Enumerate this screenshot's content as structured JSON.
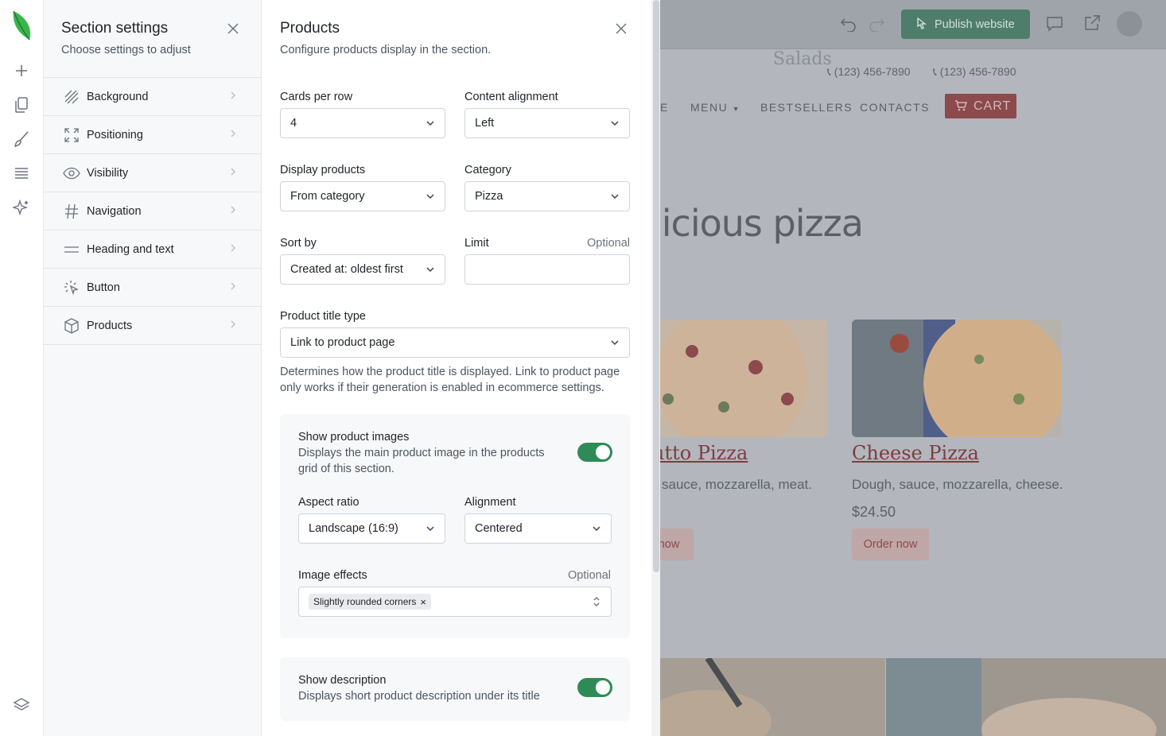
{
  "rail": {
    "icons": [
      "logo-leaf-icon",
      "add-icon",
      "pages-icon",
      "brush-icon",
      "sections-icon",
      "ai-sparkle-icon",
      "layers-icon"
    ]
  },
  "section_settings": {
    "title": "Section settings",
    "subtitle": "Choose settings to adjust",
    "items": [
      {
        "label": "Background",
        "icon": "background-hatch-icon"
      },
      {
        "label": "Positioning",
        "icon": "positioning-expand-icon"
      },
      {
        "label": "Visibility",
        "icon": "eye-icon"
      },
      {
        "label": "Navigation",
        "icon": "hash-icon"
      },
      {
        "label": "Heading and text",
        "icon": "text-lines-icon"
      },
      {
        "label": "Button",
        "icon": "cursor-click-icon"
      },
      {
        "label": "Products",
        "icon": "box-icon"
      }
    ]
  },
  "products": {
    "title": "Products",
    "subtitle": "Configure products display in the section.",
    "cards_per_row": {
      "label": "Cards per row",
      "value": "4"
    },
    "content_alignment": {
      "label": "Content alignment",
      "value": "Left"
    },
    "display_products": {
      "label": "Display products",
      "value": "From category"
    },
    "category": {
      "label": "Category",
      "value": "Pizza"
    },
    "sort_by": {
      "label": "Sort by",
      "value": "Created at: oldest first"
    },
    "limit": {
      "label": "Limit",
      "optional": "Optional",
      "value": ""
    },
    "title_type": {
      "label": "Product title type",
      "value": "Link to product page",
      "help_line1": "Determines how the product title is displayed. Link to product page",
      "help_line2": "only works if their generation is enabled in ecommerce settings."
    },
    "images_card": {
      "title": "Show product images",
      "desc_line1": "Displays the main product image in the products",
      "desc_line2": "grid of this section.",
      "enabled": true,
      "aspect_ratio": {
        "label": "Aspect ratio",
        "value": "Landscape (16:9)"
      },
      "alignment": {
        "label": "Alignment",
        "value": "Centered"
      },
      "effects": {
        "label": "Image effects",
        "optional": "Optional",
        "tag": "Slightly rounded corners",
        "tag_remove": "×"
      }
    },
    "description_card": {
      "title": "Show description",
      "desc": "Displays short product description under its title",
      "enabled": true
    }
  },
  "preview": {
    "publish_label": "Publish website",
    "nav_salads": "Salads",
    "phone1": "(123) 456-7890",
    "phone2": "(123) 456-7890",
    "nav": [
      "E",
      "MENU",
      "BESTSELLERS",
      "CONTACTS"
    ],
    "cart_label": "CART",
    "heading_fragment": "licious pizza",
    "products": [
      {
        "title": "utto Pizza",
        "desc": "sauce, mozzarella, meat.",
        "price": "",
        "order": "now"
      },
      {
        "title": "Cheese Pizza",
        "desc": "Dough, sauce, mozzarella, cheese.",
        "price": "$24.50",
        "order": "Order now"
      }
    ]
  }
}
